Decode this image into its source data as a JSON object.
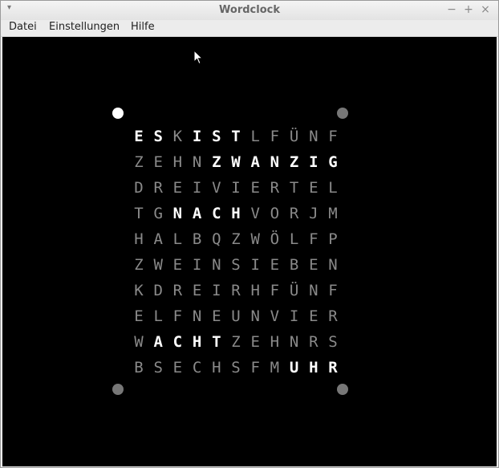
{
  "window": {
    "title": "Wordclock",
    "menu_glyph": "▾",
    "minimize_glyph": "−",
    "maximize_glyph": "+",
    "close_glyph": "×"
  },
  "menubar": {
    "items": [
      "Datei",
      "Einstellungen",
      "Hilfe"
    ]
  },
  "colors": {
    "background": "#000000",
    "letter_on": "#ffffff",
    "letter_off": "#8a8a8a",
    "dot_on": "#ffffff",
    "dot_off": "#777777"
  },
  "minute_dots": [
    {
      "position": "top-left",
      "on": true
    },
    {
      "position": "top-right",
      "on": false
    },
    {
      "position": "bottom-left",
      "on": false
    },
    {
      "position": "bottom-right",
      "on": false
    }
  ],
  "grid": {
    "rows": [
      {
        "letters": "ESKISTLFÜNF",
        "lit": [
          0,
          1,
          3,
          4,
          5
        ]
      },
      {
        "letters": "ZEHNZWANZIG",
        "lit": [
          4,
          5,
          6,
          7,
          8,
          9,
          10
        ]
      },
      {
        "letters": "DREIVIERTEL",
        "lit": []
      },
      {
        "letters": "TGNACHVORJM",
        "lit": [
          2,
          3,
          4,
          5
        ]
      },
      {
        "letters": "HALBQZWÖLFP",
        "lit": []
      },
      {
        "letters": "ZWEINSIEBEN",
        "lit": []
      },
      {
        "letters": "KDREIRHFÜNF",
        "lit": []
      },
      {
        "letters": "ELFNEUNVIER",
        "lit": []
      },
      {
        "letters": "WACHTZEHNRS",
        "lit": [
          1,
          2,
          3,
          4
        ]
      },
      {
        "letters": "BSECHSFMUHR",
        "lit": [
          8,
          9,
          10
        ]
      }
    ]
  }
}
